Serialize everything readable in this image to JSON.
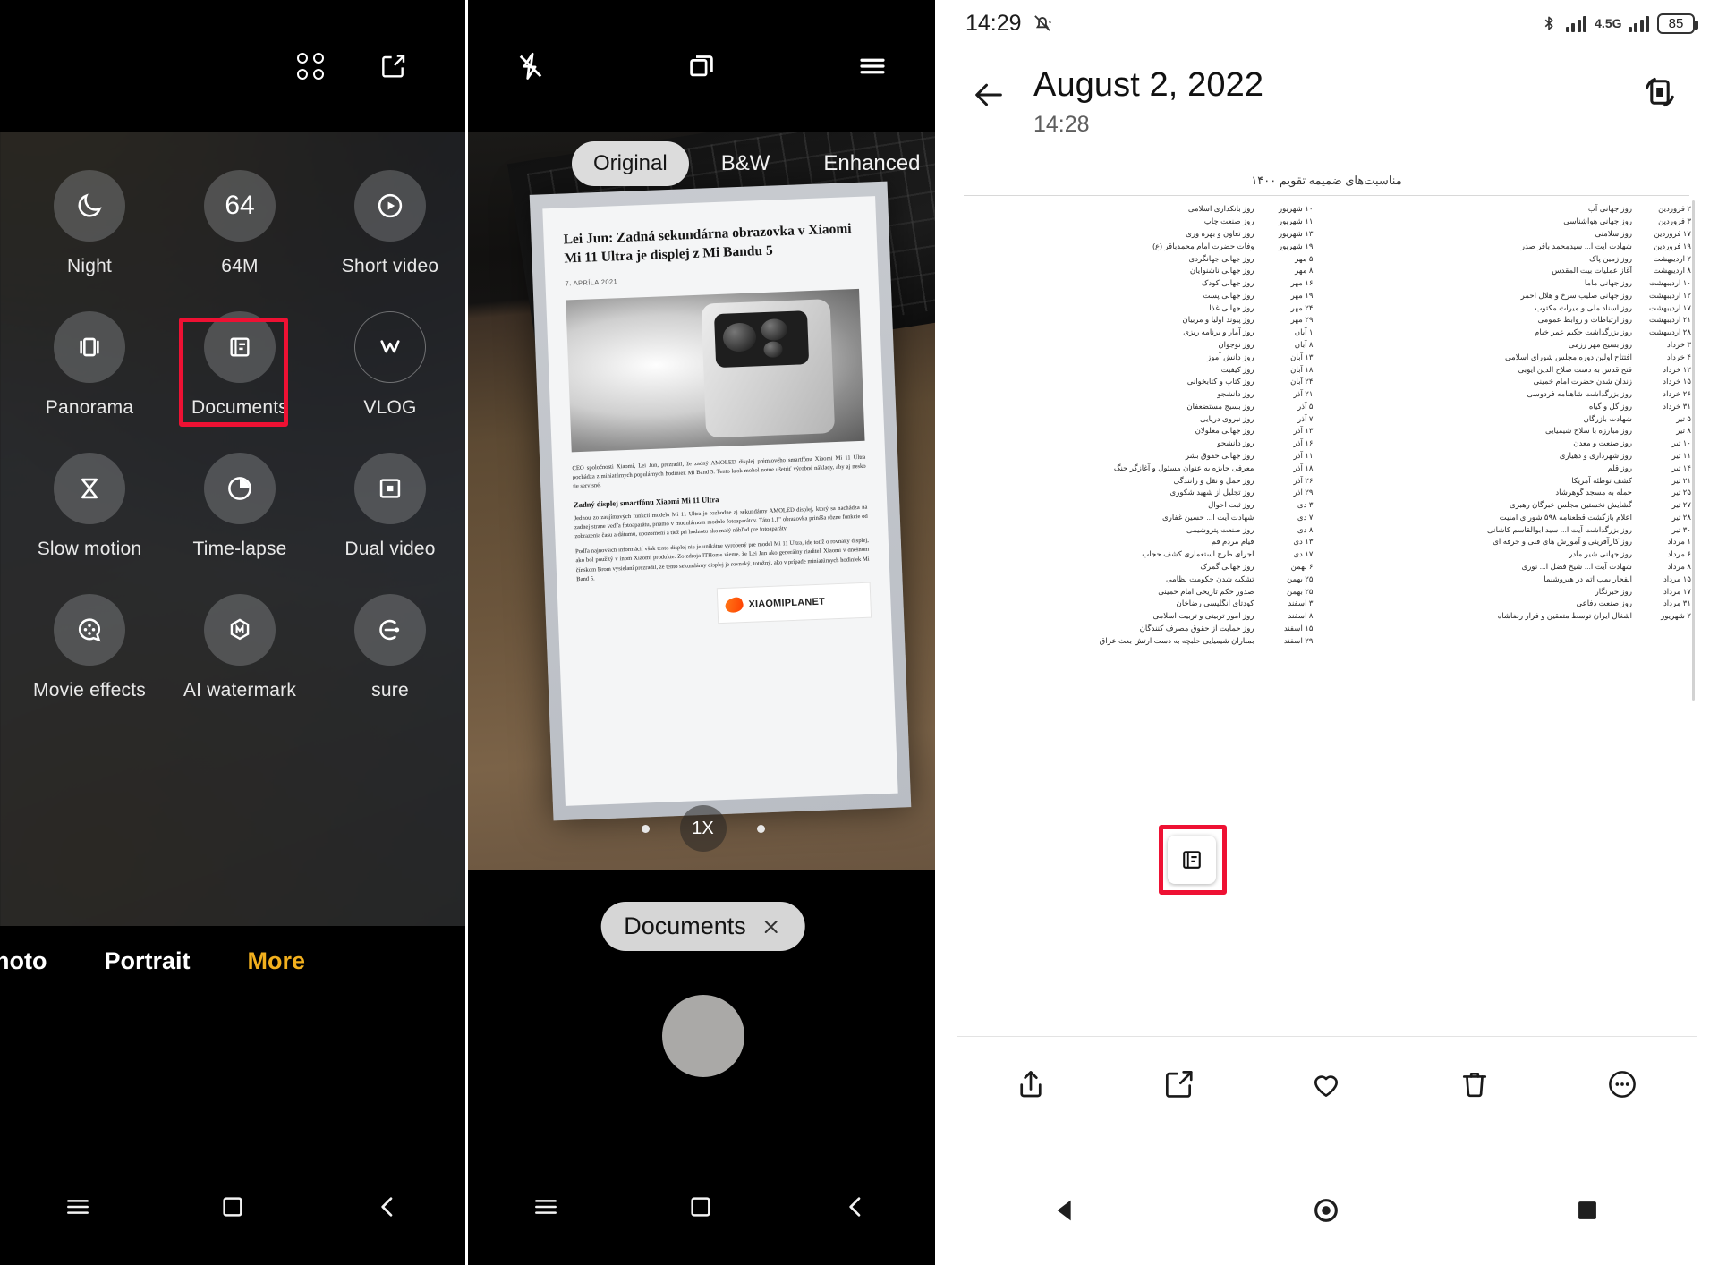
{
  "panel1": {
    "topbar": [
      {
        "name": "grid-view-icon",
        "label": "grid-view"
      },
      {
        "name": "edit-compose-icon",
        "label": "edit-compose"
      }
    ],
    "modes": [
      {
        "label": "Night",
        "icon": "moon-icon"
      },
      {
        "label": "64M",
        "icon": "64m-icon"
      },
      {
        "label": "Short video",
        "icon": "play-circle-icon"
      },
      {
        "label": "Panorama",
        "icon": "panorama-icon"
      },
      {
        "label": "Documents",
        "icon": "document-icon",
        "highlighted": true
      },
      {
        "label": "VLOG",
        "icon": "vlog-icon"
      },
      {
        "label": "Slow motion",
        "icon": "hourglass-icon"
      },
      {
        "label": "Time-lapse",
        "icon": "timelapse-icon"
      },
      {
        "label": "Dual video",
        "icon": "dual-video-icon"
      },
      {
        "label": "Movie effects",
        "icon": "movie-effects-icon"
      },
      {
        "label": "AI watermark",
        "icon": "ai-watermark-icon"
      },
      {
        "label": "sure",
        "icon": "long-exposure-icon"
      }
    ],
    "mode_bar": [
      {
        "label": "hoto",
        "active": false
      },
      {
        "label": "Portrait",
        "active": false
      },
      {
        "label": "More",
        "active": true
      }
    ],
    "highlight_color": "#ee1133",
    "accent_color": "#f2b01e"
  },
  "panel2": {
    "topbar": {
      "flash": "flash-off-icon",
      "layers": "layers-stack-icon",
      "menu": "hamburger-menu-icon"
    },
    "filters": [
      {
        "label": "Original",
        "selected": true
      },
      {
        "label": "B&W",
        "selected": false
      },
      {
        "label": "Enhanced",
        "selected": false
      }
    ],
    "document": {
      "headline": "Lei Jun: Zadná sekundárna obrazovka v Xiaomi Mi 11 Ultra je displej z Mi Bandu 5",
      "date": "7. APRÍLA 2021",
      "paragraph1": "CEO spoločnosti Xiaomi, Lei Jun, prezradil, že zadný AMOLED displej prémiového smartfónu Xiaomi Mi 11 Ultra pochádza z miniatúrnych populárnych hodiniek Mi Band 5. Tento krok mohol notne ušetriť výrobné náklady, aby aj nesko tie servisné.",
      "subhead": "Zadný displej smartfónu Xiaomi Mi 11 Ultra",
      "paragraph2": "Jednou zo zaujímavých funkcií modelu Mi 11 Ultra je rozhodne aj sekundárny AMOLED displej, ktorý sa nachádza na zadnej strane vedľa fotoaparátu, priamo v modulárnom module fotoaparátov. Táto 1,1\" obrazovka prináša rôzne funkcie od zobrazenia času a dátumu, upozornení a tiež pri hodnotu ako malý náhľad pre fotoaparáty.",
      "paragraph3": "Podľa najnovších informácií však tento displej nie je unikátne vyrobený pre model Mi 11 Ultra, ide totiž o rovnaký displej, ako bol použitý v inom Xiaomi produkte. Zo zdroja ITHome vieme, že Lei Jun ako generálny riaditeľ Xiaomi v dnešnom čínskom Brom vysielaní prezradil, že tento sekundárny displej je rovnaký, totožný, ako v prípade miniatúrnych hodiniek Mi Band 5.",
      "watermark": "XIAOMIPLANET"
    },
    "zoom_level": "1X",
    "mode_chip": {
      "label": "Documents",
      "close_icon": "close-icon"
    }
  },
  "panel3": {
    "status_bar": {
      "time": "14:29",
      "silent_icon": "bell-muted-icon",
      "bluetooth_icon": "bluetooth-icon",
      "network_label": "4.5G",
      "battery_level": "85"
    },
    "header": {
      "back_icon": "back-arrow-icon",
      "date": "August 2, 2022",
      "time": "14:28",
      "rotate_icon": "rotate-screen-icon"
    },
    "doc_title": "مناسبت‌های ضمیمه تقویم ۱۴۰۰",
    "doc_badge_icon": "document-scan-icon",
    "toolbar": [
      {
        "name": "share-button",
        "icon": "share-icon"
      },
      {
        "name": "edit-button",
        "icon": "edit-icon"
      },
      {
        "name": "favorite-button",
        "icon": "heart-icon"
      },
      {
        "name": "delete-button",
        "icon": "trash-icon"
      },
      {
        "name": "more-button",
        "icon": "more-dots-icon"
      }
    ],
    "nav": [
      {
        "name": "nav-back",
        "icon": "triangle-back-icon"
      },
      {
        "name": "nav-home",
        "icon": "circle-home-icon"
      },
      {
        "name": "nav-recents",
        "icon": "square-recents-icon"
      }
    ],
    "calendar_rows_right": [
      {
        "d": "۲ فروردین",
        "t": "روز جهانی آب"
      },
      {
        "d": "۳ فروردین",
        "t": "روز جهانی هواشناسی"
      },
      {
        "d": "۱۷ فروردین",
        "t": "روز سلامتی"
      },
      {
        "d": "۱۹ فروردین",
        "t": "شهادت آیت ا... سیدمحمد باقر صدر"
      },
      {
        "d": "۲ اردیبهشت",
        "t": "روز زمین پاک"
      },
      {
        "d": "۸ اردیبهشت",
        "t": "آغاز عملیات بیت المقدس"
      },
      {
        "d": "۱۰ اردیبهشت",
        "t": "روز جهانی ماما"
      },
      {
        "d": "۱۲ اردیبهشت",
        "t": "روز جهانی صلیب سرخ و هلال احمر"
      },
      {
        "d": "۱۷ اردیبهشت",
        "t": "روز اسناد ملی و میراث مکتوب"
      },
      {
        "d": "۲۱ اردیبهشت",
        "t": "روز ارتباطات و روابط عمومی"
      },
      {
        "d": "۲۸ اردیبهشت",
        "t": "روز بزرگداشت حکیم عمر خیام"
      },
      {
        "d": "۳ خرداد",
        "t": "روز بسیج مهر رزمی"
      },
      {
        "d": "۴ خرداد",
        "t": "افتتاح اولین دوره مجلس شورای اسلامی"
      },
      {
        "d": "۱۲ خرداد",
        "t": "فتح قدس به دست صلاح الدین ایوبی"
      },
      {
        "d": "۱۵ خرداد",
        "t": "زندان شدن حضرت امام خمینی"
      },
      {
        "d": "۲۶ خرداد",
        "t": "روز بزرگداشت شاهنامه فردوسی"
      },
      {
        "d": "۳۱ خرداد",
        "t": "روز گل و گیاه"
      },
      {
        "d": "۵ تیر",
        "t": "شهادت بازرگان"
      },
      {
        "d": "۸ تیر",
        "t": "روز مبارزه با سلاح شیمیایی"
      },
      {
        "d": "۱۰ تیر",
        "t": "روز صنعت و معدن"
      },
      {
        "d": "۱۱ تیر",
        "t": "روز شهرداری و دهیاری"
      },
      {
        "d": "۱۴ تیر",
        "t": "روز قلم"
      },
      {
        "d": "۲۱ تیر",
        "t": "کشف توطئه آمریکا"
      },
      {
        "d": "۲۵ تیر",
        "t": "حمله به مسجد گوهرشاد"
      },
      {
        "d": "۲۷ تیر",
        "t": "گشایش نخستین مجلس خبرگان رهبری"
      },
      {
        "d": "۲۸ تیر",
        "t": "اعلام بازگشت قطعنامه ۵۹۸ شورای امنیت"
      },
      {
        "d": "۳۰ تیر",
        "t": "روز بزرگداشت آیت ا... سید ابوالقاسم کاشانی"
      },
      {
        "d": "۱ مرداد",
        "t": "روز کارآفرینی و آموزش های فنی و حرفه ای"
      },
      {
        "d": "۶ مرداد",
        "t": "روز جهانی شیر مادر"
      },
      {
        "d": "۸ مرداد",
        "t": "شهادت آیت ا... شیخ فضل ا... نوری"
      },
      {
        "d": "۱۵ مرداد",
        "t": "انفجار بمب اتم در هیروشیما"
      },
      {
        "d": "۱۷ مرداد",
        "t": "روز خبرنگار"
      },
      {
        "d": "۳۱ مرداد",
        "t": "روز صنعت دفاعی"
      },
      {
        "d": "۲ شهریور",
        "t": "اشغال ایران توسط متفقین و فرار رضاشاه"
      }
    ],
    "calendar_rows_left": [
      {
        "d": "۱۰ شهریور",
        "t": "روز بانکداری اسلامی"
      },
      {
        "d": "۱۱ شهریور",
        "t": "روز صنعت چاپ"
      },
      {
        "d": "۱۳ شهریور",
        "t": "روز تعاون و بهره وری"
      },
      {
        "d": "۱۹ شهریور",
        "t": "وفات حضرت امام محمدباقر (ع)"
      },
      {
        "d": "۵ مهر",
        "t": "روز جهانی جهانگردی"
      },
      {
        "d": "۸ مهر",
        "t": "روز جهانی ناشنوایان"
      },
      {
        "d": "۱۶ مهر",
        "t": "روز جهانی کودک"
      },
      {
        "d": "۱۹ مهر",
        "t": "روز جهانی پست"
      },
      {
        "d": "۲۴ مهر",
        "t": "روز جهانی غذا"
      },
      {
        "d": "۲۹ مهر",
        "t": "روز پیوند اولیا و مربیان"
      },
      {
        "d": "۱ آبان",
        "t": "روز آمار و برنامه ریزی"
      },
      {
        "d": "۸ آبان",
        "t": "روز نوجوان"
      },
      {
        "d": "۱۳ آبان",
        "t": "روز دانش آموز"
      },
      {
        "d": "۱۸ آبان",
        "t": "روز کیفیت"
      },
      {
        "d": "۲۴ آبان",
        "t": "روز کتاب و کتابخوانی"
      },
      {
        "d": "۲۱ آذر",
        "t": "روز دانشجو"
      },
      {
        "d": "۵ آذر",
        "t": "روز بسیج مستضعفان"
      },
      {
        "d": "۷ آذر",
        "t": "روز نیروی دریایی"
      },
      {
        "d": "۱۳ آذر",
        "t": "روز جهانی معلولان"
      },
      {
        "d": "۱۶ آذر",
        "t": "روز دانشجو"
      },
      {
        "d": "۱۱ آذر",
        "t": "روز جهانی حقوق بشر"
      },
      {
        "d": "۱۸ آذر",
        "t": "معرفی جایزه به عنوان مسئول و آغازگر جنگ"
      },
      {
        "d": "۲۶ آذر",
        "t": "روز حمل و نقل و رانندگی"
      },
      {
        "d": "۲۹ آذر",
        "t": "روز تجلیل از شهید شکوری"
      },
      {
        "d": "۳ دی",
        "t": "روز ثبت احوال"
      },
      {
        "d": "۷ دی",
        "t": "شهادت آیت ا... حسین غفاری"
      },
      {
        "d": "۸ دی",
        "t": "روز صنعت پتروشیمی"
      },
      {
        "d": "۱۳ دی",
        "t": "قیام مردم قم"
      },
      {
        "d": "۱۷ دی",
        "t": "اجرای طرح استعماری کشف حجاب"
      },
      {
        "d": "۶ بهمن",
        "t": "روز جهانی گمرک"
      },
      {
        "d": "۲۵ بهمن",
        "t": "تشکیه شدن حکومت نظامی"
      },
      {
        "d": "۲۵ بهمن",
        "t": "صدور حکم تاریخی امام خمینی"
      },
      {
        "d": "۳ اسفند",
        "t": "کودتای انگلیسی رضاخان"
      },
      {
        "d": "۸ اسفند",
        "t": "روز امور تربیتی و تربیت اسلامی"
      },
      {
        "d": "۱۵ اسفند",
        "t": "روز حمایت از حقوق مصرف کنندگان"
      },
      {
        "d": "۲۹ اسفند",
        "t": "بمباران شیمیایی حلبچه به دست ارتش بعث عراق"
      }
    ]
  }
}
